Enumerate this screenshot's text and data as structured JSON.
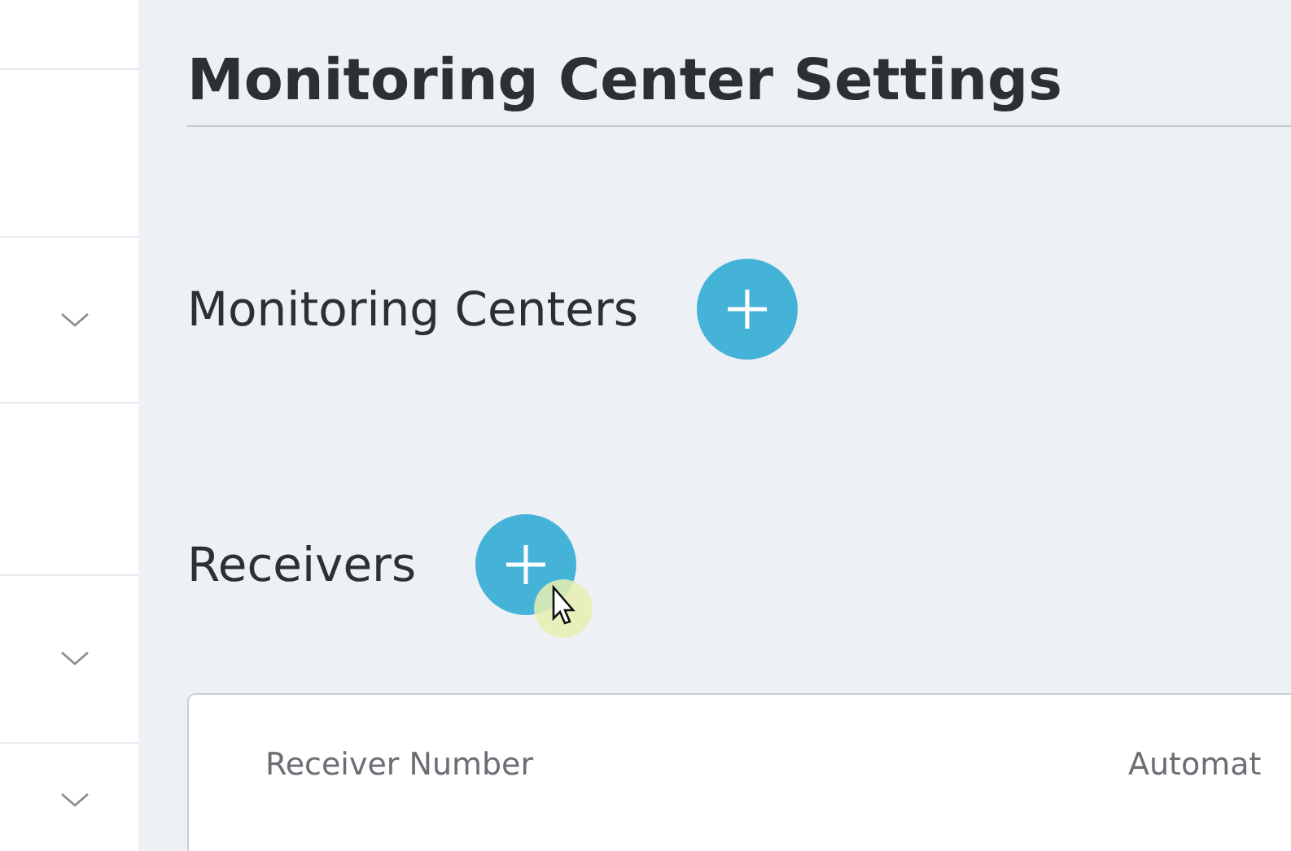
{
  "sidebar": {
    "rows": [
      {
        "kind": "plain"
      },
      {
        "kind": "plain"
      },
      {
        "kind": "expandable"
      },
      {
        "kind": "plain"
      },
      {
        "kind": "expandable"
      },
      {
        "kind": "expandable"
      }
    ]
  },
  "page": {
    "title": "Monitoring Center Settings"
  },
  "sections": [
    {
      "heading": "Monitoring Centers"
    },
    {
      "heading": "Receivers"
    }
  ],
  "table": {
    "columns": [
      "Receiver Number",
      "Automat"
    ]
  }
}
